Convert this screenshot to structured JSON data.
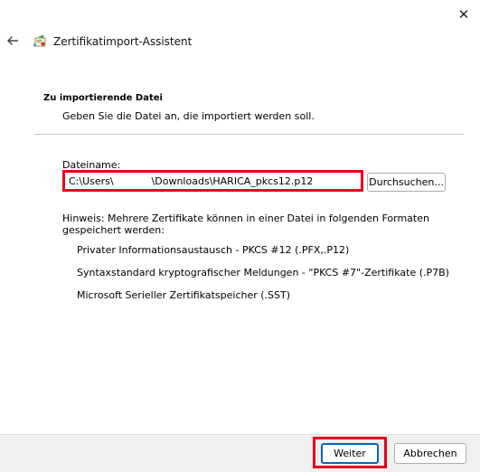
{
  "window": {
    "close_icon": "close-icon",
    "back_icon": "back-arrow-icon",
    "wizard_icon": "certificate-wizard-icon",
    "title": "Zertifikatimport-Assistent"
  },
  "section": {
    "heading": "Zu importierende Datei",
    "subtitle": "Geben Sie die Datei an, die importiert werden soll."
  },
  "file": {
    "label": "Dateiname:",
    "value": "C:\\Users\\            \\Downloads\\HARICA_pkcs12.p12",
    "browse_label": "Durchsuchen..."
  },
  "note": {
    "text": "Hinweis: Mehrere Zertifikate können in einer Datei in folgenden Formaten gespeichert werden:",
    "formats": [
      "Privater Informationsaustausch - PKCS #12 (.PFX,.P12)",
      "Syntaxstandard kryptografischer Meldungen - \"PKCS #7\"-Zertifikate (.P7B)",
      "Microsoft Serieller Zertifikatspeicher (.SST)"
    ]
  },
  "footer": {
    "next_label": "Weiter",
    "cancel_label": "Abbrechen"
  },
  "colors": {
    "highlight": "#e4001b",
    "accent": "#0067c0",
    "footer_bg": "#f0f0f0"
  }
}
